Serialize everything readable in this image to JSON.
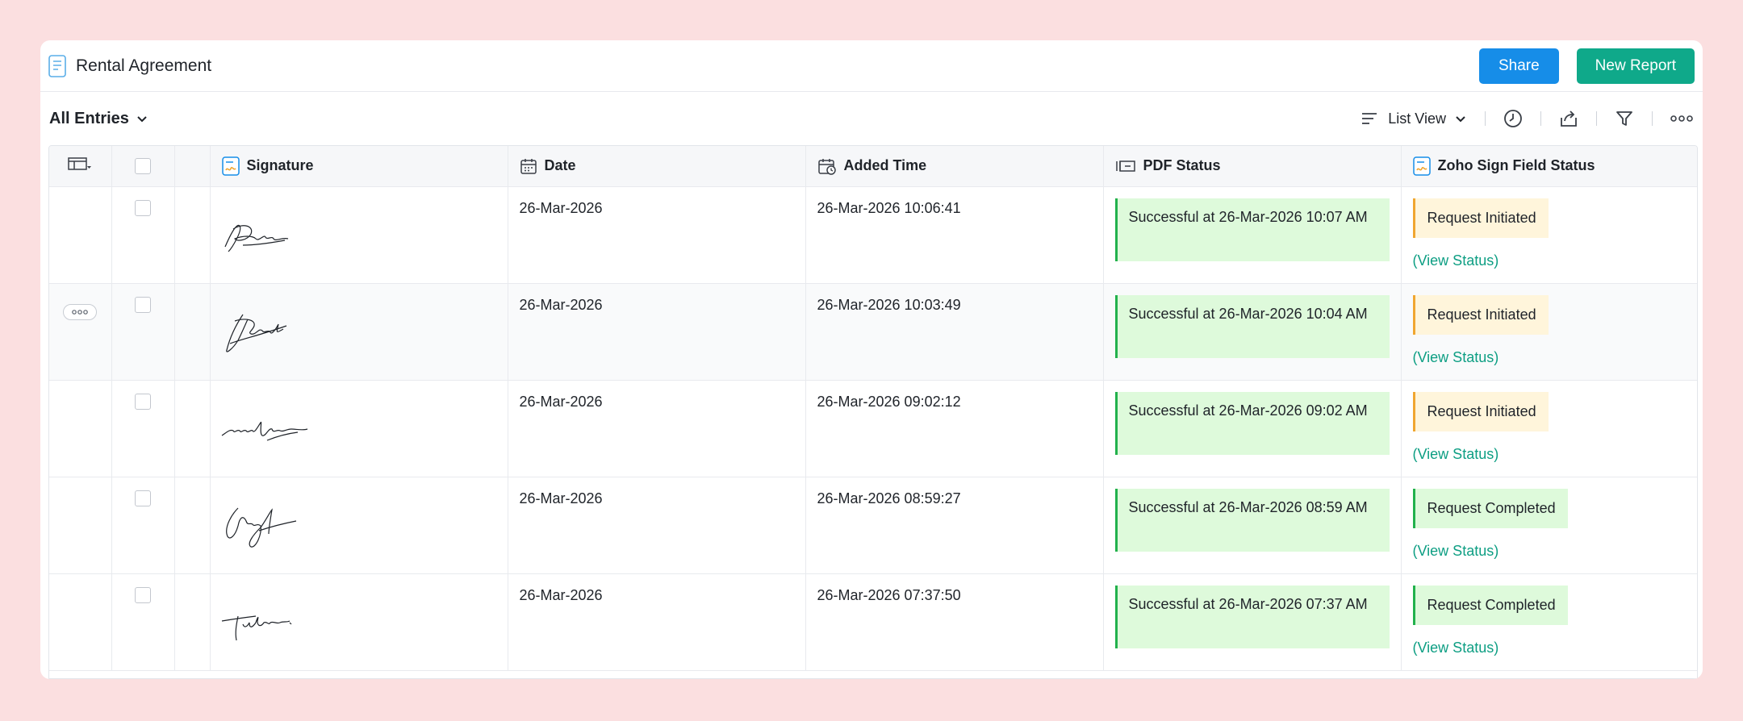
{
  "report": {
    "title": "Rental Agreement",
    "share_label": "Share",
    "new_report_label": "New Report"
  },
  "toolbar": {
    "entries_label": "All Entries",
    "view_label": "List View"
  },
  "table": {
    "headers": {
      "signature": "Signature",
      "date": "Date",
      "added_time": "Added Time",
      "pdf_status": "PDF Status",
      "zoho_sign_status": "Zoho Sign Field Status"
    },
    "view_status_label": "(View Status)",
    "rows": [
      {
        "date": "26-Mar-2026",
        "added_time": "26-Mar-2026 10:06:41",
        "pdf_status": "Successful at 26-Mar-2026 10:07 AM",
        "sign_status": "Request Initiated"
      },
      {
        "date": "26-Mar-2026",
        "added_time": "26-Mar-2026 10:03:49",
        "pdf_status": "Successful at 26-Mar-2026 10:04 AM",
        "sign_status": "Request Initiated"
      },
      {
        "date": "26-Mar-2026",
        "added_time": "26-Mar-2026 09:02:12",
        "pdf_status": "Successful at 26-Mar-2026 09:02 AM",
        "sign_status": "Request Initiated"
      },
      {
        "date": "26-Mar-2026",
        "added_time": "26-Mar-2026 08:59:27",
        "pdf_status": "Successful at 26-Mar-2026 08:59 AM",
        "sign_status": "Request Completed"
      },
      {
        "date": "26-Mar-2026",
        "added_time": "26-Mar-2026 07:37:50",
        "pdf_status": "Successful at 26-Mar-2026 07:37 AM",
        "sign_status": "Request Completed"
      }
    ]
  },
  "colors": {
    "background": "#fbdfe0",
    "share_button": "#168de8",
    "new_report_button": "#0fa98a",
    "success_fill": "#defadb",
    "success_border": "#22b14c",
    "initiated_fill": "#fff5db",
    "initiated_border": "#f0a630",
    "link": "#0d9e83"
  },
  "icons": {
    "report": "document-list-icon",
    "entries_dropdown": "chevron-down-icon",
    "view": "list-lines-icon",
    "history": "clock-icon",
    "export": "export-icon",
    "filter": "filter-funnel-icon",
    "more": "more-dots-icon",
    "column_settings": "column-settings-icon",
    "signature_field": "signature-field-icon",
    "date_field": "calendar-icon",
    "added_time_field": "calendar-clock-icon",
    "pdf_field": "pdf-field-icon"
  }
}
